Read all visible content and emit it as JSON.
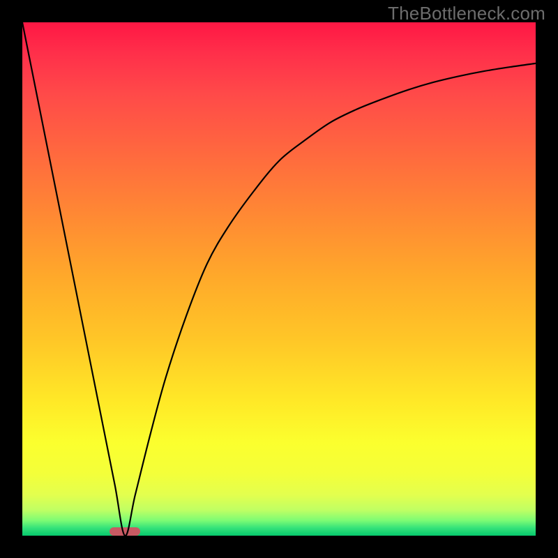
{
  "watermark": "TheBottleneck.com",
  "colors": {
    "gradient_top": "#ff1744",
    "gradient_bottom": "#07c96d",
    "frame": "#000000",
    "curve": "#000000",
    "marker": "#c85a63",
    "watermark_text": "#6d6d6d"
  },
  "chart_data": {
    "type": "line",
    "title": "",
    "xlabel": "",
    "ylabel": "",
    "xlim": [
      0,
      100
    ],
    "ylim": [
      0,
      100
    ],
    "grid": false,
    "legend": false,
    "annotations": [],
    "marker": {
      "x_center": 20,
      "width_pct": 6,
      "y": 0
    },
    "series": [
      {
        "name": "curve",
        "x": [
          0,
          5,
          10,
          15,
          18,
          20,
          22,
          25,
          28,
          32,
          36,
          40,
          45,
          50,
          55,
          60,
          65,
          70,
          75,
          80,
          85,
          90,
          95,
          100
        ],
        "values": [
          100,
          75,
          50,
          25,
          10,
          0,
          8,
          20,
          31,
          43,
          53,
          60,
          67,
          73,
          77,
          80.5,
          83,
          85,
          86.8,
          88.3,
          89.5,
          90.5,
          91.3,
          92
        ]
      }
    ]
  }
}
